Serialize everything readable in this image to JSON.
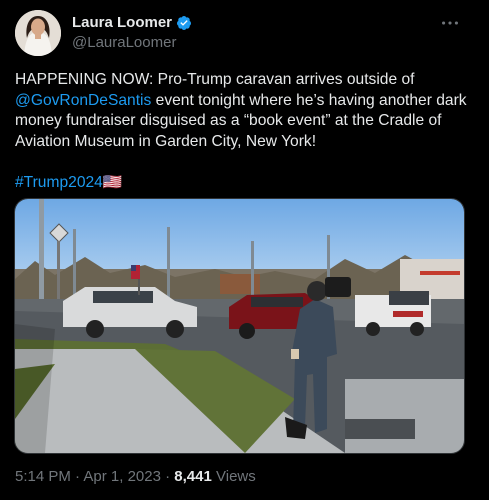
{
  "author": {
    "name": "Laura Loomer",
    "handle": "@LauraLoomer"
  },
  "tweet": {
    "text_part1": "HAPPENING NOW: Pro-Trump caravan arrives outside of ",
    "mention": "@GovRonDeSantis",
    "text_part2": " event tonight where he’s having another dark money fundraiser disguised as a “book event” at the Cradle of Aviation Museum in Garden City, New York!",
    "hashtag": "#Trump2024",
    "flag_emoji": "🇺🇸"
  },
  "meta": {
    "time": "5:14 PM",
    "separator1": " · ",
    "date": "Apr 1, 2023",
    "separator2": " · ",
    "views_count": "8,441",
    "views_label": " Views"
  },
  "colors": {
    "background": "#000000",
    "text": "#e7e9ea",
    "secondary": "#71767b",
    "accent": "#1d9bf0"
  },
  "icons": [
    "verified-badge-icon",
    "more-options-icon"
  ]
}
